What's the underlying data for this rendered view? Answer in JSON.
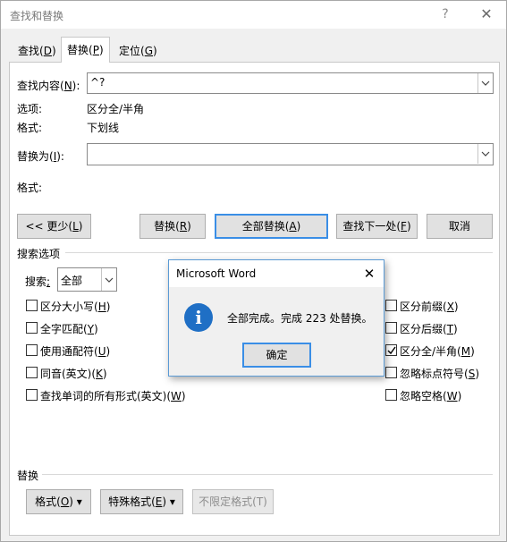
{
  "dialog": {
    "title": "查找和替换",
    "help_glyph": "?",
    "close_glyph": "✕"
  },
  "tabs": [
    {
      "text": "查找(",
      "key": "D",
      "end": ")"
    },
    {
      "text": "替换(",
      "key": "P",
      "end": ")"
    },
    {
      "text": "定位(",
      "key": "G",
      "end": ")"
    }
  ],
  "find": {
    "label_text": "查找内容(",
    "label_key": "N",
    "label_end": "):",
    "value": "^?",
    "options_label": "选项:",
    "options_value": "区分全/半角",
    "format_label": "格式:",
    "format_value": "下划线"
  },
  "replace": {
    "label_text": "替换为(",
    "label_key": "I",
    "label_end": "):",
    "value": "",
    "format_label": "格式:"
  },
  "buttons": {
    "less": {
      "text": "<< 更少(",
      "key": "L",
      "end": ")"
    },
    "replace": {
      "text": "替换(",
      "key": "R",
      "end": ")"
    },
    "replace_all": {
      "text": "全部替换(",
      "key": "A",
      "end": ")"
    },
    "find_next": {
      "text": "查找下一处(",
      "key": "F",
      "end": ")"
    },
    "cancel": "取消"
  },
  "search_options": {
    "section_label": "搜索选项",
    "search_label_text": "搜索",
    "search_label_key": ";",
    "search_value": "全部",
    "left_checks": [
      {
        "text": "区分大小写(",
        "key": "H",
        "end": ")",
        "checked": false
      },
      {
        "text": "全字匹配(",
        "key": "Y",
        "end": ")",
        "checked": false
      },
      {
        "text": "使用通配符(",
        "key": "U",
        "end": ")",
        "checked": false
      },
      {
        "text": "同音(英文)(",
        "key": "K",
        "end": ")",
        "checked": false
      },
      {
        "text": "查找单词的所有形式(英文)(",
        "key": "W",
        "end": ")",
        "checked": false
      }
    ],
    "right_checks": [
      {
        "text": "区分前缀(",
        "key": "X",
        "end": ")",
        "checked": false
      },
      {
        "text": "区分后缀(",
        "key": "T",
        "end": ")",
        "checked": false
      },
      {
        "text": "区分全/半角(",
        "key": "M",
        "end": ")",
        "checked": true
      },
      {
        "text": "忽略标点符号(",
        "key": "S",
        "end": ")",
        "checked": false
      },
      {
        "text": "忽略空格(",
        "key": "W",
        "end": ")",
        "checked": false
      }
    ]
  },
  "replace_section": {
    "label": "替换",
    "format_btn": {
      "text": "格式(",
      "key": "O",
      "end": ") ▾"
    },
    "special_btn": {
      "text": "特殊格式(",
      "key": "E",
      "end": ") ▾"
    },
    "no_format_btn": "不限定格式(T)"
  },
  "message_box": {
    "title": "Microsoft Word",
    "close_glyph": "✕",
    "icon": "info-icon",
    "icon_glyph": "i",
    "message": "全部完成。完成 223 处替换。",
    "ok": "确定"
  },
  "colors": {
    "accent": "#3a8ee6",
    "info": "#1f6fc5"
  }
}
